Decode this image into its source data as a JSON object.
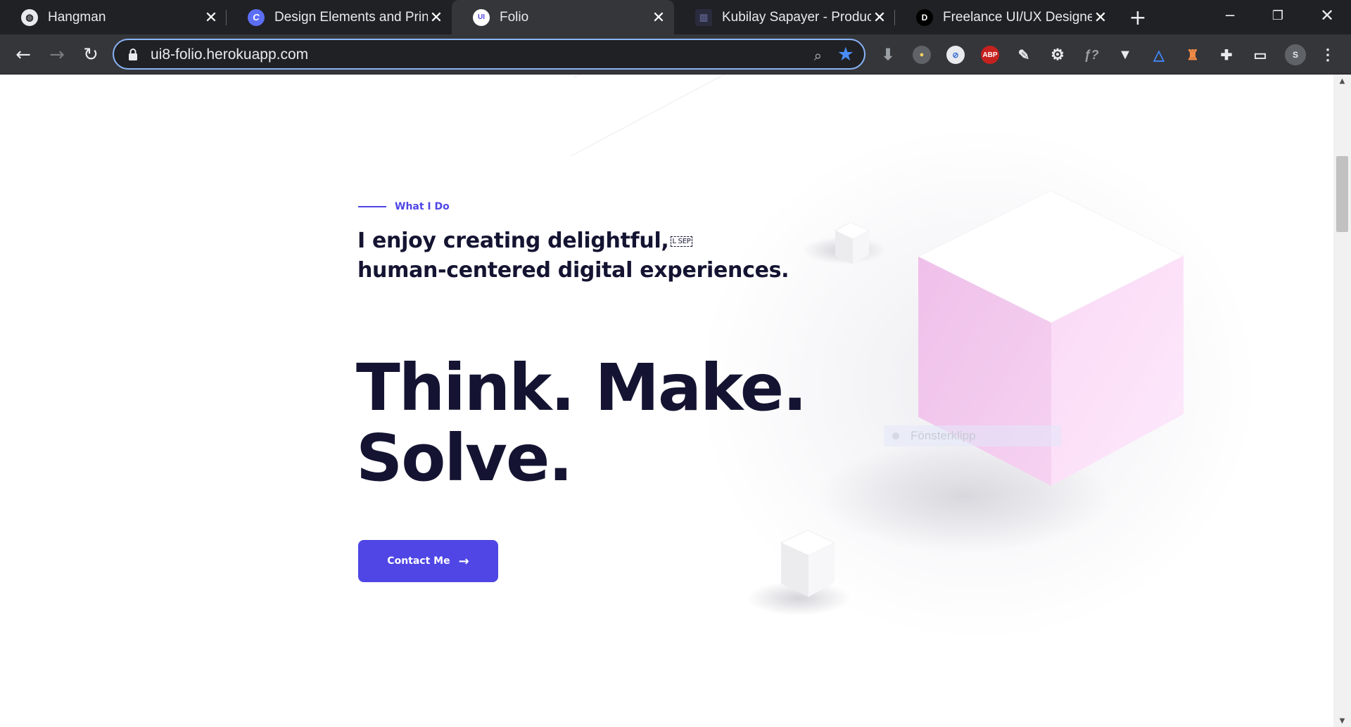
{
  "browser": {
    "tabs": [
      {
        "title": "Hangman",
        "icon": "globe-icon",
        "active": false
      },
      {
        "title": "Design Elements and Princi",
        "icon": "canva-icon",
        "active": false
      },
      {
        "title": "Folio",
        "icon": "ui8-icon",
        "active": true
      },
      {
        "title": "Kubilay Sapayer - Product D",
        "icon": "portfolio-icon",
        "active": false
      },
      {
        "title": "Freelance UI/UX Designer -",
        "icon": "d-logo-icon",
        "active": false
      }
    ],
    "url": "ui8-folio.herokuapp.com",
    "extensions": {
      "abp_label": "ABP",
      "profile_initial": "S"
    }
  },
  "section": {
    "eyebrow": "What I Do",
    "subheading_line1": "I enjoy creating delightful,",
    "sep_glyph": "L SEP",
    "subheading_line2": "human-centered digital experiences.",
    "hero_line1": "Think. Make.",
    "hero_line2": "Solve.",
    "cta_label": "Contact Me"
  },
  "overlay": {
    "tooltip_text": "Fönsterklipp"
  },
  "colors": {
    "accent": "#4f46e5",
    "heading": "#141432",
    "cube_pink": "#f2c6ec",
    "chrome_dark": "#202124",
    "chrome_tab": "#35363a"
  }
}
